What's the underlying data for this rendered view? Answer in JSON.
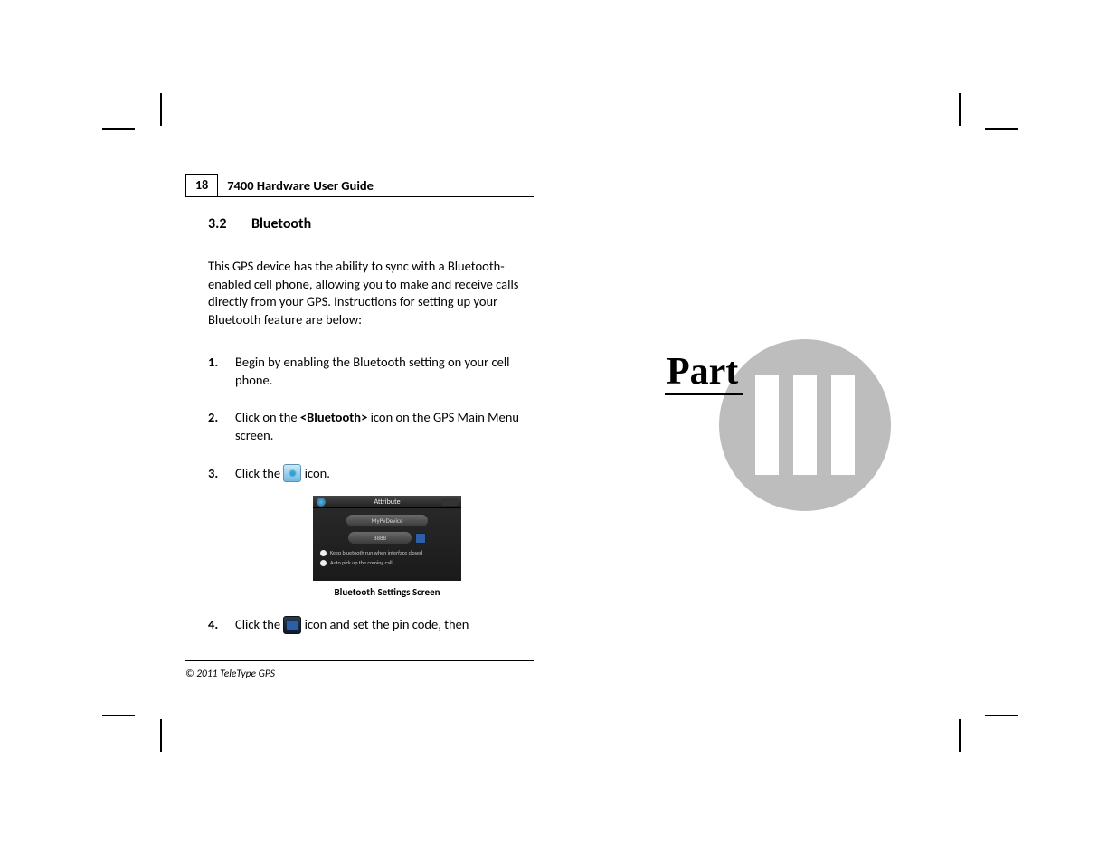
{
  "header": {
    "page_number": "18",
    "doc_title": "7400 Hardware User Guide"
  },
  "section": {
    "number": "3.2",
    "title": "Bluetooth"
  },
  "intro": "This GPS device has the ability to sync with a Bluetooth-enabled cell phone, allowing you to make and receive calls directly from your GPS. Instructions for setting up your Bluetooth feature are below:",
  "steps": {
    "s1": {
      "n": "1.",
      "text": "Begin by enabling the Bluetooth setting on your cell phone."
    },
    "s2": {
      "n": "2.",
      "pre": "Click on the ",
      "bold": "<Bluetooth>",
      "post": " icon on the GPS Main Menu screen."
    },
    "s3": {
      "n": "3.",
      "pre": "Click the ",
      "post": " icon."
    },
    "s4": {
      "n": "4.",
      "pre": "Click the ",
      "post": " icon and set the pin code, then"
    }
  },
  "screenshot": {
    "title": "Attribute",
    "device": "MyPvDevice",
    "pin": "8888",
    "opt1": "Keep bluetooth run when interface closed",
    "opt2": "Auto pick up the coming call",
    "caption": "Bluetooth Settings Screen"
  },
  "footer": {
    "copyright": "© 2011 TeleType GPS"
  },
  "part": {
    "label": "Part",
    "roman": "III"
  }
}
